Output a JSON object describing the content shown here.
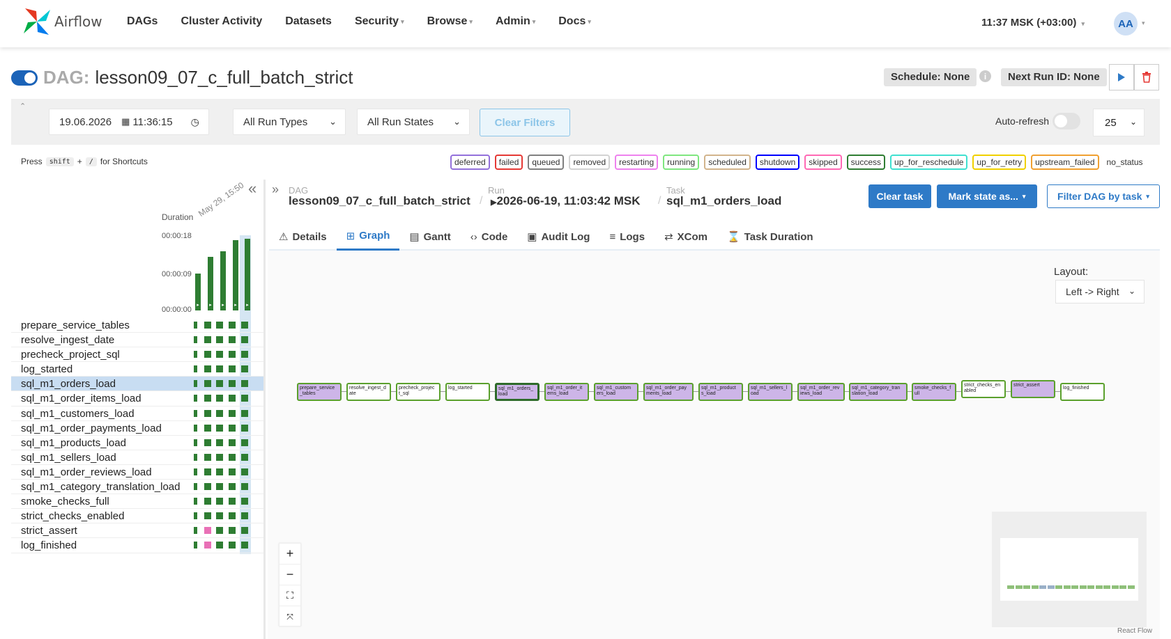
{
  "app": {
    "name": "Airflow"
  },
  "nav": {
    "items": [
      {
        "label": "DAGs",
        "dropdown": false
      },
      {
        "label": "Cluster Activity",
        "dropdown": false
      },
      {
        "label": "Datasets",
        "dropdown": false
      },
      {
        "label": "Security",
        "dropdown": true
      },
      {
        "label": "Browse",
        "dropdown": true
      },
      {
        "label": "Admin",
        "dropdown": true
      },
      {
        "label": "Docs",
        "dropdown": true
      }
    ],
    "time": "11:37 MSK (+03:00)",
    "avatar": "AA"
  },
  "dag": {
    "label": "DAG:",
    "name": "lesson09_07_c_full_batch_strict",
    "schedule": "Schedule: None",
    "next_run": "Next Run ID: None",
    "paused": false
  },
  "filters": {
    "date": "19.06.2026",
    "time": "11:36:15",
    "run_types": "All Run Types",
    "run_states": "All Run States",
    "clear_label": "Clear Filters",
    "auto_refresh_label": "Auto-refresh",
    "page_size": "25"
  },
  "shortcuts": {
    "press": "Press",
    "key1": "shift",
    "plus": "+",
    "key2": "/",
    "suffix": "for Shortcuts"
  },
  "legend": [
    {
      "label": "deferred",
      "color": "#9370db"
    },
    {
      "label": "failed",
      "color": "#e53935"
    },
    {
      "label": "queued",
      "color": "#808080"
    },
    {
      "label": "removed",
      "color": "#d3d3d3"
    },
    {
      "label": "restarting",
      "color": "#ee82ee"
    },
    {
      "label": "running",
      "color": "#7fe67f"
    },
    {
      "label": "scheduled",
      "color": "#d2b48c"
    },
    {
      "label": "shutdown",
      "color": "#0000ff"
    },
    {
      "label": "skipped",
      "color": "#ff69b4"
    },
    {
      "label": "success",
      "color": "#2e7d32"
    },
    {
      "label": "up_for_reschedule",
      "color": "#40e0d0"
    },
    {
      "label": "up_for_retry",
      "color": "#f0d000"
    },
    {
      "label": "upstream_failed",
      "color": "#f0a030"
    },
    {
      "label": "no_status",
      "color": "#ffffff"
    }
  ],
  "grid": {
    "duration_label": "Duration",
    "date_label": "May 29, 15:50",
    "y_ticks": [
      "00:00:18",
      "00:00:09",
      "00:00:00"
    ],
    "run_durations_sec": [
      10,
      14.5,
      16,
      19,
      19.5
    ],
    "tasks": [
      {
        "name": "prepare_service_tables",
        "states": [
          "success",
          "success",
          "success",
          "success",
          "success"
        ]
      },
      {
        "name": "resolve_ingest_date",
        "states": [
          "success",
          "success",
          "success",
          "success",
          "success"
        ]
      },
      {
        "name": "precheck_project_sql",
        "states": [
          "success",
          "success",
          "success",
          "success",
          "success"
        ]
      },
      {
        "name": "log_started",
        "states": [
          "success",
          "success",
          "success",
          "success",
          "success"
        ]
      },
      {
        "name": "sql_m1_orders_load",
        "states": [
          "success",
          "success",
          "success",
          "success",
          "success"
        ],
        "selected": true
      },
      {
        "name": "sql_m1_order_items_load",
        "states": [
          "success",
          "success",
          "success",
          "success",
          "success"
        ]
      },
      {
        "name": "sql_m1_customers_load",
        "states": [
          "success",
          "success",
          "success",
          "success",
          "success"
        ]
      },
      {
        "name": "sql_m1_order_payments_load",
        "states": [
          "success",
          "success",
          "success",
          "success",
          "success"
        ]
      },
      {
        "name": "sql_m1_products_load",
        "states": [
          "success",
          "success",
          "success",
          "success",
          "success"
        ]
      },
      {
        "name": "sql_m1_sellers_load",
        "states": [
          "success",
          "success",
          "success",
          "success",
          "success"
        ]
      },
      {
        "name": "sql_m1_order_reviews_load",
        "states": [
          "success",
          "success",
          "success",
          "success",
          "success"
        ]
      },
      {
        "name": "sql_m1_category_translation_load",
        "states": [
          "success",
          "success",
          "success",
          "success",
          "success"
        ]
      },
      {
        "name": "smoke_checks_full",
        "states": [
          "success",
          "success",
          "success",
          "success",
          "success"
        ]
      },
      {
        "name": "strict_checks_enabled",
        "states": [
          "success",
          "success",
          "success",
          "success",
          "success"
        ]
      },
      {
        "name": "strict_assert",
        "states": [
          "success",
          "skipped",
          "success",
          "success",
          "success"
        ]
      },
      {
        "name": "log_finished",
        "states": [
          "success",
          "skipped",
          "success",
          "success",
          "success"
        ]
      }
    ]
  },
  "breadcrumb": {
    "dag_label": "DAG",
    "dag_value": "lesson09_07_c_full_batch_strict",
    "run_label": "Run",
    "run_value": "2026-06-19, 11:03:42 MSK",
    "task_label": "Task",
    "task_value": "sql_m1_orders_load"
  },
  "actions": {
    "clear_task": "Clear task",
    "mark_state": "Mark state as...",
    "filter_dag": "Filter DAG by task"
  },
  "tabs": [
    {
      "label": "Details",
      "icon": "warning-icon",
      "glyph": "⚠"
    },
    {
      "label": "Graph",
      "icon": "graph-icon",
      "glyph": "⊞",
      "active": true
    },
    {
      "label": "Gantt",
      "icon": "gantt-icon",
      "glyph": "▤"
    },
    {
      "label": "Code",
      "icon": "code-icon",
      "glyph": "‹›"
    },
    {
      "label": "Audit Log",
      "icon": "audit-icon",
      "glyph": "▣"
    },
    {
      "label": "Logs",
      "icon": "logs-icon",
      "glyph": "≡"
    },
    {
      "label": "XCom",
      "icon": "xcom-icon",
      "glyph": "⇄"
    },
    {
      "label": "Task Duration",
      "icon": "hourglass-icon",
      "glyph": "⌛"
    }
  ],
  "graph": {
    "layout_label": "Layout:",
    "layout_value": "Left -> Right",
    "nodes": [
      {
        "label": "prepare_service\n_tables",
        "style": "purple"
      },
      {
        "label": "resolve_ingest_d\nate",
        "style": "white"
      },
      {
        "label": "precheck_projec\nt_sql",
        "style": "white"
      },
      {
        "label": "log_started",
        "style": "white"
      },
      {
        "label": "sql_m1_orders_\nload",
        "style": "purple",
        "selected": true
      },
      {
        "label": "sql_m1_order_it\nems_load",
        "style": "purple"
      },
      {
        "label": "sql_m1_custom\ners_load",
        "style": "purple"
      },
      {
        "label": "sql_m1_order_pay\nments_load",
        "style": "purple"
      },
      {
        "label": "sql_m1_product\ns_load",
        "style": "purple"
      },
      {
        "label": "sql_m1_sellers_l\noad",
        "style": "purple"
      },
      {
        "label": "sql_m1_order_rev\niews_load",
        "style": "purple"
      },
      {
        "label": "sql_m1_category_tran\nslation_load",
        "style": "purple"
      },
      {
        "label": "smoke_checks_f\null",
        "style": "purple"
      },
      {
        "label": "strict_checks_en\nabled",
        "style": "white"
      },
      {
        "label": "strict_assert",
        "style": "purple"
      },
      {
        "label": "log_finished",
        "style": "white"
      }
    ],
    "react_flow": "React Flow"
  },
  "colors": {
    "accent": "#2e7ac7",
    "success": "#2e7d32",
    "skipped": "#e970b6",
    "node_bg": "#cdb5e8"
  }
}
